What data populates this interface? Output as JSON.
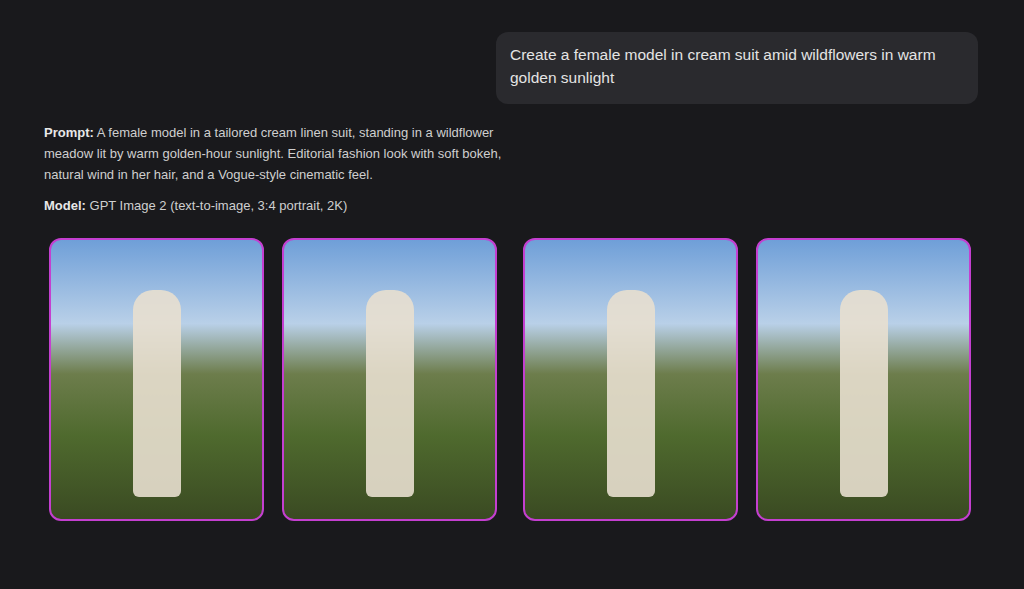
{
  "message": "Create a female model in cream suit amid wildflowers in warm golden sunlight",
  "prompt": {
    "label": "Prompt:",
    "text": "A female model in a tailored cream linen suit, standing in a wildflower meadow lit by warm golden-hour sunlight. Editorial fashion look with soft bokeh, natural wind in her hair, and a Vogue-style cinematic feel."
  },
  "model": {
    "label": "Model:",
    "text": "GPT Image 2 (text-to-image, 3:4 portrait, 2K)"
  },
  "images": [
    {},
    {},
    {},
    {}
  ]
}
